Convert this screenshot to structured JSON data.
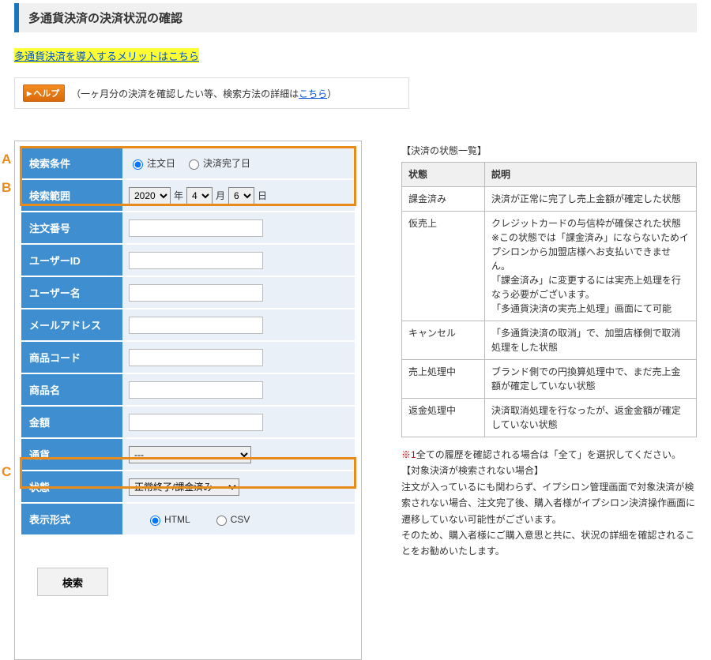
{
  "title": "多通貨決済の決済状況の確認",
  "promo_link": "多通貨決済を導入するメリットはこちら",
  "help": {
    "button": "ヘルプ",
    "text_prefix": "（一ヶ月分の決済を確認したい等、検索方法の詳細は",
    "link": "こちら",
    "text_suffix": "）"
  },
  "markers": {
    "a": "A",
    "b": "B",
    "c": "C"
  },
  "form": {
    "rows": {
      "cond": {
        "label": "検索条件",
        "opt1": "注文日",
        "opt2": "決済完了日"
      },
      "range": {
        "label": "検索範囲",
        "year": "2020",
        "y_suffix": "年",
        "month": "4",
        "m_suffix": "月",
        "day": "6",
        "d_suffix": "日"
      },
      "order": {
        "label": "注文番号"
      },
      "uid": {
        "label": "ユーザーID"
      },
      "uname": {
        "label": "ユーザー名"
      },
      "mail": {
        "label": "メールアドレス"
      },
      "pcode": {
        "label": "商品コード"
      },
      "pname": {
        "label": "商品名"
      },
      "amount": {
        "label": "金額"
      },
      "currency": {
        "label": "通貨",
        "value": "---"
      },
      "status": {
        "label": "状態",
        "value": "正常終了/課金済み"
      },
      "format": {
        "label": "表示形式",
        "html": "HTML",
        "csv": "CSV"
      }
    },
    "submit": "検索"
  },
  "statuses": {
    "caption": "【決済の状態一覧】",
    "head_a": "状態",
    "head_b": "説明",
    "rows": [
      {
        "name": "課金済み",
        "desc": "決済が正常に完了し売上金額が確定した状態"
      },
      {
        "name": "仮売上",
        "desc": "クレジットカードの与信枠が確保された状態\n※この状態では「課金済み」にならないためイプシロンから加盟店様へお支払いできません。\n「課金済み」に変更するには実売上処理を行なう必要がございます。\n「多通貨決済の実売上処理」画面にて可能"
      },
      {
        "name": "キャンセル",
        "desc": "「多通貨決済の取消」で、加盟店様側で取消処理をした状態"
      },
      {
        "name": "売上処理中",
        "desc": "ブランド側での円換算処理中で、まだ売上金額が確定していない状態"
      },
      {
        "name": "返金処理中",
        "desc": "決済取消処理を行なったが、返金金額が確定していない状態"
      }
    ]
  },
  "notes": {
    "n1_prefix": "※1",
    "n1_body": "全ての履歴を確認される場合は「全て」を選択してください。",
    "n2": "【対象決済が検索されない場合】",
    "n3": "注文が入っているにも関わらず、イプシロン管理画面で対象決済が検索されない場合、注文完了後、購入者様がイプシロン決済操作画面に遷移していない可能性がございます。",
    "n4": "そのため、購入者様にご購入意思と共に、状況の詳細を確認されることをお勧めいたします。"
  }
}
